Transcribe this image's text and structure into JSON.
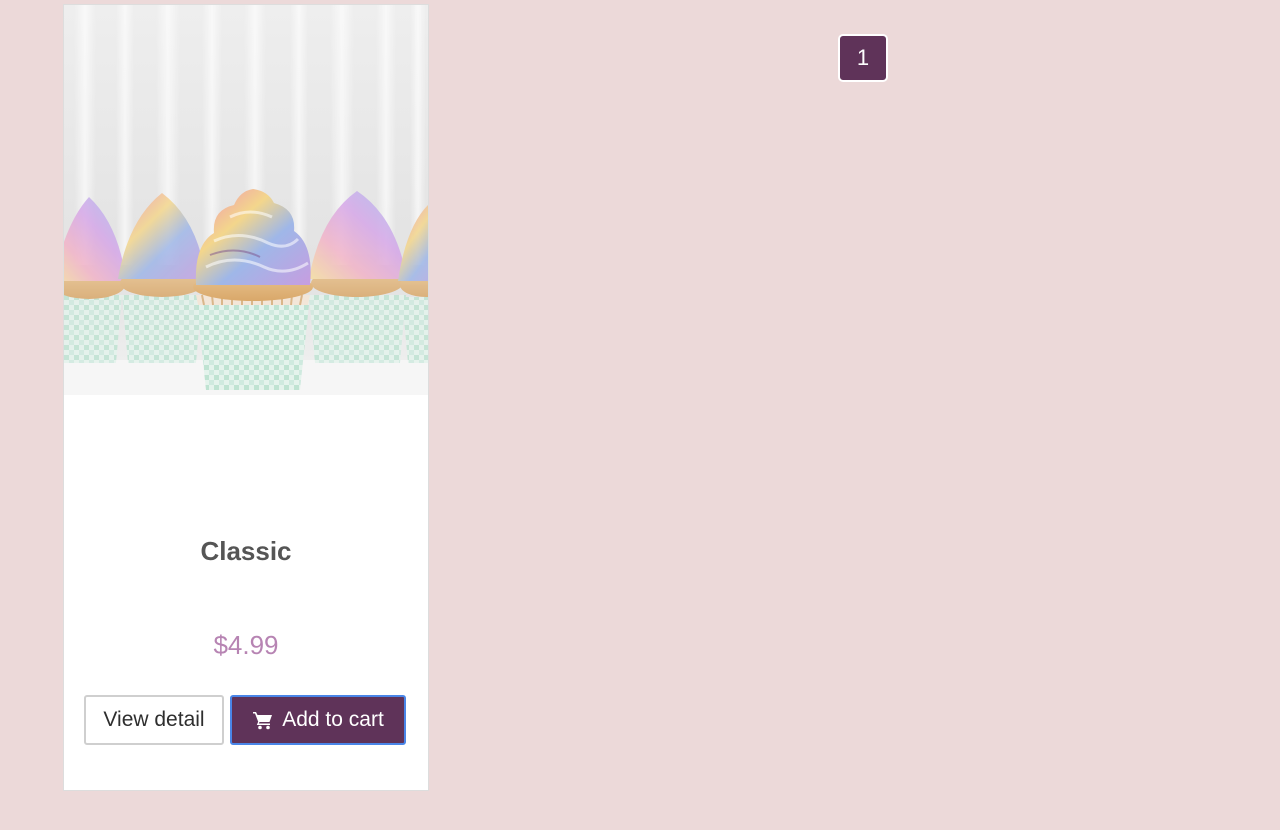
{
  "product": {
    "name": "Classic",
    "price": "$4.99",
    "image_alt": "cupcakes-photo",
    "view_label": "View detail",
    "cart_label": "Add to cart",
    "cart_icon": "shopping-cart-icon"
  },
  "pagination": {
    "current_page": "1"
  },
  "colors": {
    "background": "#ecd9d9",
    "brand": "#5f3359",
    "price": "#b784b3",
    "focus": "#4a86e8"
  }
}
